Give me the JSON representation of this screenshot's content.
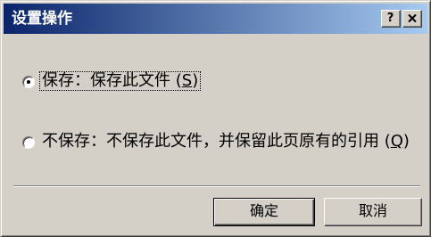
{
  "window": {
    "title": "设置操作",
    "help_glyph": "?",
    "help_icon": "help-icon",
    "close_icon": "close-icon"
  },
  "options": [
    {
      "label": "保存：保存此文件",
      "accel_open": " (",
      "accel": "S",
      "accel_close": ")",
      "selected": true
    },
    {
      "label": "不保存：不保存此文件，并保留此页原有的引用",
      "accel_open": " (",
      "accel": "Q",
      "accel_close": ")",
      "selected": false
    }
  ],
  "buttons": {
    "ok_label": "确定",
    "cancel_label": "取消"
  },
  "colors": {
    "face": "#d4d0c8",
    "title_start": "#0a246a",
    "title_end": "#a6caf0",
    "title_text": "#ffffff"
  }
}
